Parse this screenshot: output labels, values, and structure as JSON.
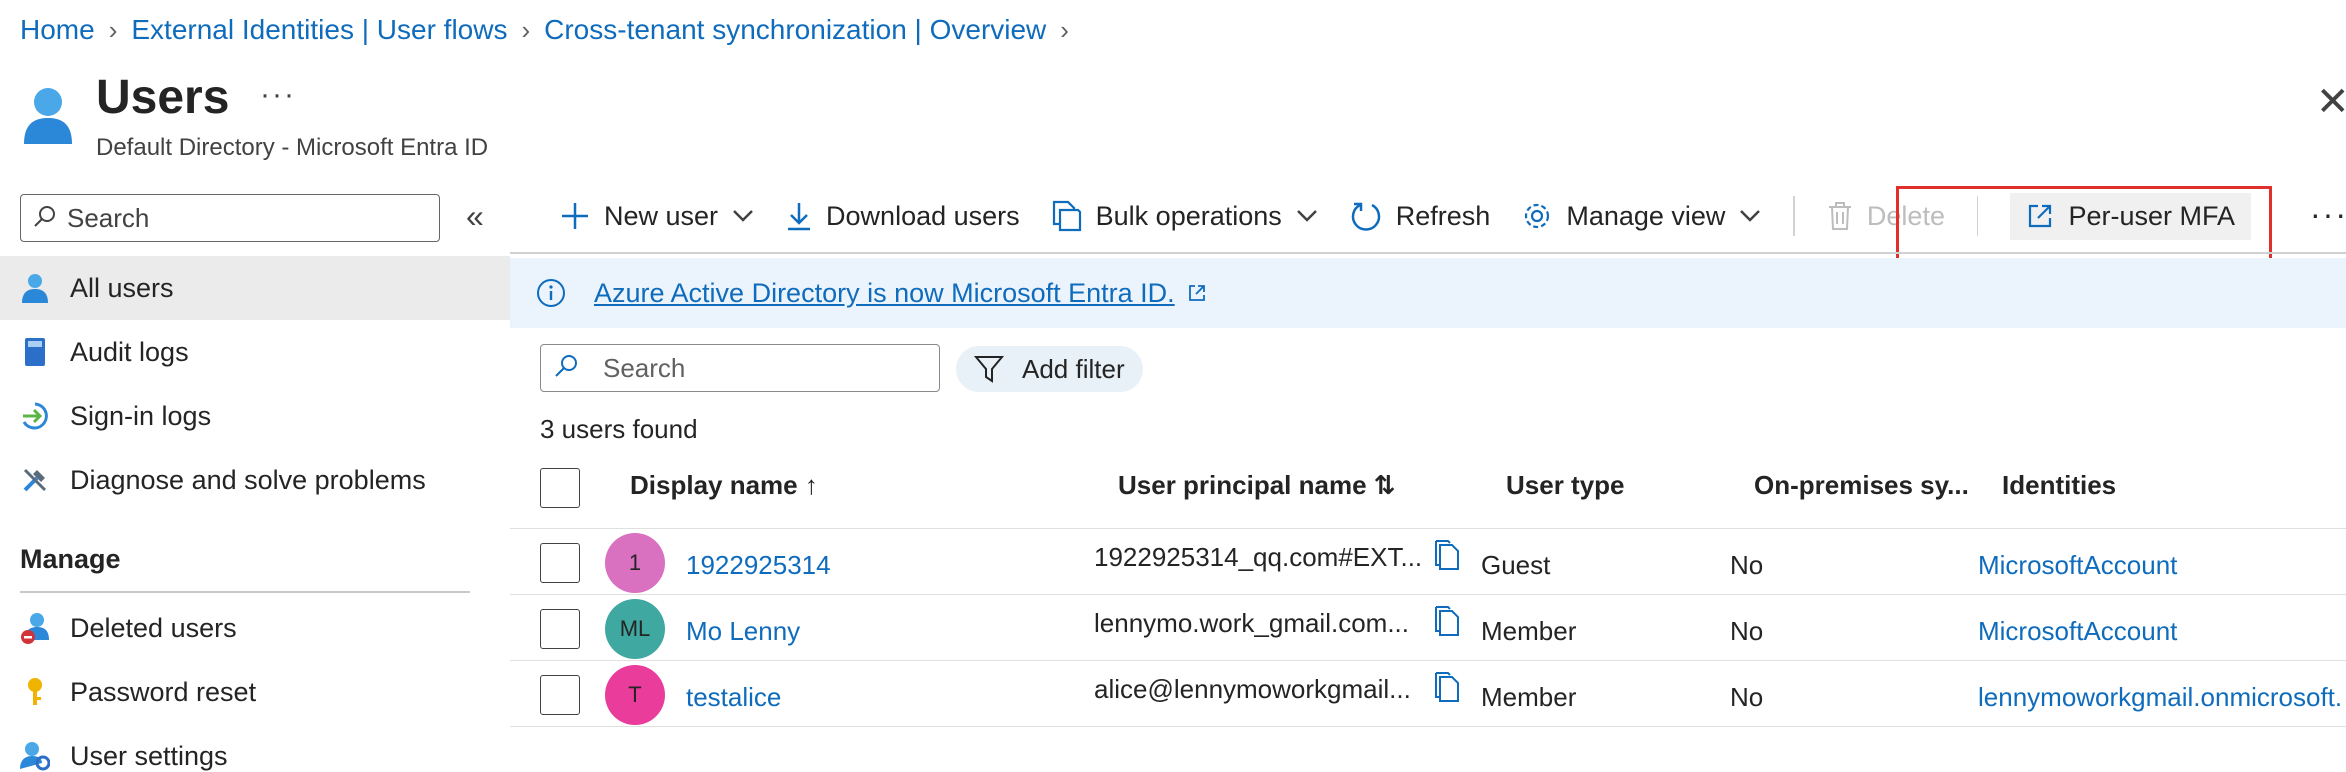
{
  "breadcrumb": {
    "items": [
      "Home",
      "External Identities | User flows",
      "Cross-tenant synchronization | Overview"
    ]
  },
  "header": {
    "title": "Users",
    "more": "···",
    "subtitle": "Default Directory - Microsoft Entra ID",
    "close": "✕"
  },
  "sidebar": {
    "search_placeholder": "Search",
    "collapse": "«",
    "items": [
      {
        "label": "All users",
        "icon": "user-icon"
      },
      {
        "label": "Audit logs",
        "icon": "book-icon"
      },
      {
        "label": "Sign-in logs",
        "icon": "sign-in-icon"
      },
      {
        "label": "Diagnose and solve problems",
        "icon": "wrench-icon"
      }
    ],
    "manage_header": "Manage",
    "manage_items": [
      {
        "label": "Deleted users",
        "icon": "deleted-user-icon"
      },
      {
        "label": "Password reset",
        "icon": "key-icon"
      },
      {
        "label": "User settings",
        "icon": "user-settings-icon"
      }
    ]
  },
  "toolbar": {
    "new_user": "New user",
    "download_users": "Download users",
    "bulk_operations": "Bulk operations",
    "refresh": "Refresh",
    "manage_view": "Manage view",
    "delete": "Delete",
    "per_user_mfa": "Per-user MFA",
    "more": "···"
  },
  "banner": {
    "text": "Azure Active Directory is now Microsoft Entra ID."
  },
  "main": {
    "search_placeholder": "Search",
    "add_filter": "Add filter",
    "users_found": "3 users found"
  },
  "table": {
    "columns": {
      "display_name": "Display name ↑",
      "upn": "User principal name ⇅",
      "user_type": "User type",
      "on_prem": "On-premises sy...",
      "identities": "Identities"
    },
    "rows": [
      {
        "initials": "1",
        "avatar_color": "#da70c0",
        "display_name": "1922925314",
        "upn": "1922925314_qq.com#EXT...",
        "user_type": "Guest",
        "on_prem": "No",
        "identities": "MicrosoftAccount"
      },
      {
        "initials": "ML",
        "avatar_color": "#3fa8a0",
        "display_name": "Mo Lenny",
        "upn": "lennymo.work_gmail.com...",
        "user_type": "Member",
        "on_prem": "No",
        "identities": "MicrosoftAccount"
      },
      {
        "initials": "T",
        "avatar_color": "#ea3c9a",
        "display_name": "testalice",
        "upn": "alice@lennymoworkgmail...",
        "user_type": "Member",
        "on_prem": "No",
        "identities": "lennymoworkgmail.onmicrosoft."
      }
    ]
  },
  "colors": {
    "accent": "#0f6cbd",
    "highlight": "#e0302c",
    "banner_bg": "#ebf3fc"
  }
}
